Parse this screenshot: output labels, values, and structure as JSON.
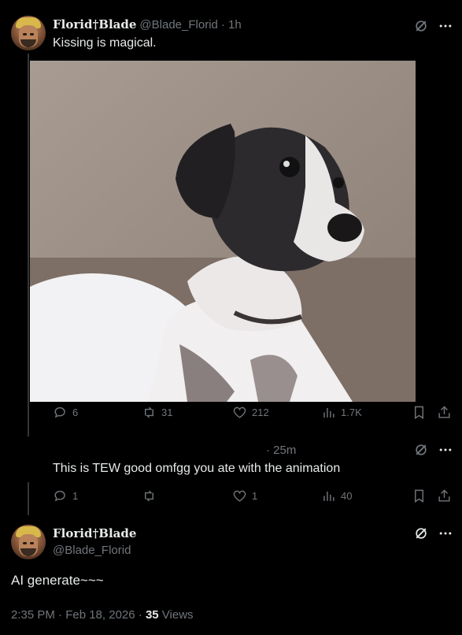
{
  "tweets": [
    {
      "display_name": "Florid†Blade",
      "handle": "@Blade_Florid",
      "time": "· 1h",
      "text": "Kissing is magical.",
      "actions": {
        "replies": "6",
        "retweets": "31",
        "likes": "212",
        "views": "1.7K"
      }
    },
    {
      "time": "· 25m",
      "text": "This is TEW good omfgg you ate with the animation",
      "actions": {
        "replies": "1",
        "retweets": "",
        "likes": "1",
        "views": "40"
      }
    }
  ],
  "main_post": {
    "display_name": "Florid†Blade",
    "handle": "@Blade_Florid",
    "text": "AI generate~~~",
    "timestamp": "2:35 PM · Feb 18, 2026 · ",
    "views_count": "35",
    "views_label": " Views"
  },
  "colors": {
    "background": "#000000",
    "text": "#e7e9ea",
    "muted": "#71767b",
    "divider": "#333639"
  },
  "icons": [
    "grok-icon",
    "more-icon",
    "reply-icon",
    "retweet-icon",
    "like-icon",
    "views-icon",
    "bookmark-icon",
    "share-icon"
  ]
}
